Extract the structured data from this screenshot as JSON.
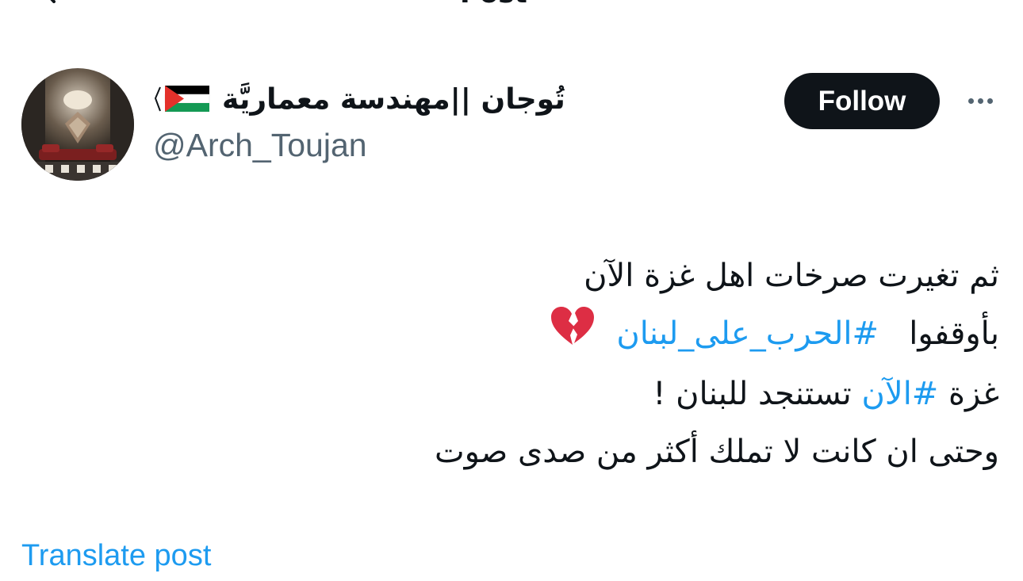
{
  "header": {
    "title": "Post",
    "back_icon": "back-arrow-icon"
  },
  "author": {
    "display_name": "تُوجان ||مهندسة معماريَّة",
    "flag_icon": "palestine-flag-icon",
    "handle": "@Arch_Toujan",
    "avatar_icon": "avatar-image"
  },
  "actions": {
    "follow_label": "Follow",
    "more_icon": "more-horizontal-icon"
  },
  "tweet": {
    "line1": "ثم تغيرت صرخات اهل غزة الآن",
    "line2_prefix": "بأوقفوا",
    "line2_hashtag": "#الحرب_على_لبنان",
    "line2_emoji_icon": "broken-heart-icon",
    "line3_prefix": "غزة",
    "line3_hashtag": "#الآن",
    "line3_suffix": "تستنجد للبنان !",
    "line4": "وحتى ان كانت لا تملك أكثر من صدى صوت"
  },
  "translate": {
    "label": "Translate post"
  },
  "colors": {
    "text": "#0f1419",
    "secondary": "#536471",
    "link": "#1d9bf0",
    "button_bg": "#0f1419"
  }
}
